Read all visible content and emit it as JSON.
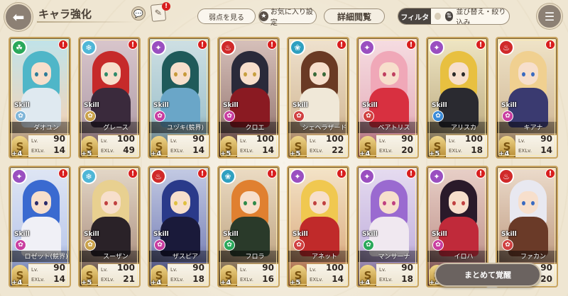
{
  "header": {
    "title": "キャラ強化",
    "note_badge": "!",
    "weakness_label": "弱点を見る",
    "favorite_label": "お気に入り設定",
    "detail_label": "詳細閲覧",
    "filter_label": "フィルタ",
    "sort_label": "並び替え・絞り込み"
  },
  "cards": [
    {
      "name": "ダオユン",
      "skill": "Skill",
      "lv_label": "Lv.",
      "exlv_label": "EXLv.",
      "lv": "90",
      "exlv": "14",
      "plus": "+4",
      "element_icon": "clover-icon",
      "element_color": "#2aa85a",
      "trait_color": "#7fb5d8",
      "hair": "#4fb6c8",
      "eye": "#2d7c98",
      "outfit": "#dfe9f0",
      "bg1": "#bfe3ea",
      "bg2": "#e9d6c1",
      "bg3": "#8a6a4a"
    },
    {
      "name": "グレース",
      "skill": "Skill",
      "lv_label": "Lv.",
      "exlv_label": "EXLv.",
      "lv": "100",
      "exlv": "49",
      "plus": "+5",
      "element_icon": "ice-icon",
      "element_color": "#4fb6d6",
      "trait_color": "#caa24a",
      "hair": "#c62a2a",
      "eye": "#2f8a6a",
      "outfit": "#3a2a3c",
      "bg1": "#d9c6cc",
      "bg2": "#b9a6b0",
      "bg3": "#5a4040"
    },
    {
      "name": "ユヅキ(競界)",
      "skill": "Skill",
      "lv_label": "Lv.",
      "exlv_label": "EXLv.",
      "lv": "90",
      "exlv": "14",
      "plus": "+4",
      "element_icon": "dark-icon",
      "element_color": "#9a4fc0",
      "trait_color": "#c93ea0",
      "hair": "#1f5a5a",
      "eye": "#c89a3a",
      "outfit": "#6aa6c8",
      "bg1": "#cfe0e4",
      "bg2": "#a6c6cf",
      "bg3": "#4a5a60"
    },
    {
      "name": "クロエ",
      "skill": "Skill",
      "lv_label": "Lv.",
      "exlv_label": "EXLv.",
      "lv": "100",
      "exlv": "14",
      "plus": "+5",
      "element_icon": "fire-icon",
      "element_color": "#d02a2a",
      "trait_color": "#c93ea0",
      "hair": "#2a2a3a",
      "eye": "#c8a040",
      "outfit": "#8a1a22",
      "bg1": "#d7c1bb",
      "bg2": "#a68a84",
      "bg3": "#3a2020"
    },
    {
      "name": "シェヘラザード",
      "skill": "Skill",
      "lv_label": "Lv.",
      "exlv_label": "EXLv.",
      "lv": "100",
      "exlv": "22",
      "plus": "+5",
      "element_icon": "water-icon",
      "element_color": "#2fa0c0",
      "trait_color": "#d04040",
      "hair": "#6a3a24",
      "eye": "#3a6a3a",
      "outfit": "#f0e8d8",
      "bg1": "#efe2cf",
      "bg2": "#d8c0a0",
      "bg3": "#8a6040"
    },
    {
      "name": "ベアトリス",
      "skill": "Skill",
      "lv_label": "Lv.",
      "exlv_label": "EXLv.",
      "lv": "90",
      "exlv": "20",
      "plus": "+4",
      "element_icon": "dark-icon",
      "element_color": "#9a4fc0",
      "trait_color": "#d04040",
      "hair": "#f0a8b8",
      "eye": "#c04060",
      "outfit": "#d83040",
      "bg1": "#f6dde2",
      "bg2": "#e8b8c2",
      "bg3": "#8a4050"
    },
    {
      "name": "アリスカ",
      "skill": "Skill",
      "lv_label": "Lv.",
      "exlv_label": "EXLv.",
      "lv": "100",
      "exlv": "18",
      "plus": "+5",
      "element_icon": "dark-icon",
      "element_color": "#9a4fc0",
      "trait_color": "#3a8ad8",
      "hair": "#e8c040",
      "eye": "#2a2a2a",
      "outfit": "#2a2a30",
      "bg1": "#efe6c4",
      "bg2": "#c8b890",
      "bg3": "#4a4030"
    },
    {
      "name": "キアナ",
      "skill": "Skill",
      "lv_label": "Lv.",
      "exlv_label": "EXLv.",
      "lv": "90",
      "exlv": "14",
      "plus": "+4",
      "element_icon": "fire-icon",
      "element_color": "#d02a2a",
      "trait_color": "#c93ea0",
      "hair": "#f0d090",
      "eye": "#3a6ac0",
      "outfit": "#3a3a70",
      "bg1": "#f0e4c8",
      "bg2": "#d6c0a0",
      "bg3": "#6a5038"
    },
    {
      "name": "ロゼット(競界)",
      "skill": "Skill",
      "lv_label": "Lv.",
      "exlv_label": "EXLv.",
      "lv": "90",
      "exlv": "14",
      "plus": "+4",
      "element_icon": "dark-icon",
      "element_color": "#9a4fc0",
      "trait_color": "#c93ea0",
      "hair": "#3a6ad0",
      "eye": "#2a2a6a",
      "outfit": "#f0f0f6",
      "bg1": "#dfe6f4",
      "bg2": "#c0ccec",
      "bg3": "#4a5890"
    },
    {
      "name": "スーザン",
      "skill": "Skill",
      "lv_label": "Lv.",
      "exlv_label": "EXLv.",
      "lv": "100",
      "exlv": "21",
      "plus": "+5",
      "element_icon": "ice-icon",
      "element_color": "#4fb6d6",
      "trait_color": "#caa24a",
      "hair": "#e8d090",
      "eye": "#c04040",
      "outfit": "#2a2228",
      "bg1": "#e4d8c8",
      "bg2": "#b8a090",
      "bg3": "#3a2a28"
    },
    {
      "name": "ザスピア",
      "skill": "Skill",
      "lv_label": "Lv.",
      "exlv_label": "EXLv.",
      "lv": "90",
      "exlv": "18",
      "plus": "+4",
      "element_icon": "fire-icon",
      "element_color": "#d02a2a",
      "trait_color": "#c93ea0",
      "hair": "#2a3a8a",
      "eye": "#e0c040",
      "outfit": "#1a1a3a",
      "bg1": "#c4cbe4",
      "bg2": "#8890c0",
      "bg3": "#2a2a50"
    },
    {
      "name": "フロラ",
      "skill": "Skill",
      "lv_label": "Lv.",
      "exlv_label": "EXLv.",
      "lv": "90",
      "exlv": "16",
      "plus": "+4",
      "element_icon": "water-icon",
      "element_color": "#2fa0c0",
      "trait_color": "#2aa85a",
      "hair": "#e08030",
      "eye": "#2f8a4a",
      "outfit": "#2a3a2a",
      "bg1": "#ecdcc4",
      "bg2": "#c8b090",
      "bg3": "#4a3a28"
    },
    {
      "name": "アネット",
      "skill": "Skill",
      "lv_label": "Lv.",
      "exlv_label": "EXLv.",
      "lv": "100",
      "exlv": "14",
      "plus": "+5",
      "element_icon": "dark-icon",
      "element_color": "#9a4fc0",
      "trait_color": "#d04040",
      "hair": "#f0c850",
      "eye": "#c04040",
      "outfit": "#c02a2a",
      "bg1": "#f4e4c8",
      "bg2": "#e0b890",
      "bg3": "#8a4028"
    },
    {
      "name": "マンサーナ",
      "skill": "Skill",
      "lv_label": "Lv.",
      "exlv_label": "EXLv.",
      "lv": "90",
      "exlv": "18",
      "plus": "+4",
      "element_icon": "dark-icon",
      "element_color": "#9a4fc0",
      "trait_color": "#2aa85a",
      "hair": "#9a6ad0",
      "eye": "#c04080",
      "outfit": "#f0e8f0",
      "bg1": "#e6dcf0",
      "bg2": "#c8b8e0",
      "bg3": "#5a4a70"
    },
    {
      "name": "イロハ",
      "skill": "Skill",
      "lv_label": "Lv.",
      "exlv_label": "EXLv.",
      "lv": "",
      "exlv": "",
      "plus": "+4",
      "element_icon": "dark-icon",
      "element_color": "#9a4fc0",
      "trait_color": "#c93ea0",
      "hair": "#2a1a2a",
      "eye": "#c04040",
      "outfit": "#c02a3a",
      "bg1": "#e8d0c8",
      "bg2": "#c8a098",
      "bg3": "#4a2028"
    },
    {
      "name": "ファカン",
      "skill": "Skill",
      "lv_label": "Lv.",
      "exlv_label": "EXLv.",
      "lv": "90",
      "exlv": "20",
      "plus": "+4",
      "element_icon": "fire-icon",
      "element_color": "#d02a2a",
      "trait_color": "#d04040",
      "hair": "#e8e8f0",
      "eye": "#3a6ac0",
      "outfit": "#6a3a28",
      "bg1": "#ecdccc",
      "bg2": "#c8a890",
      "bg3": "#5a3a28"
    }
  ],
  "footer": {
    "awaken_label": "まとめて覚醒"
  }
}
